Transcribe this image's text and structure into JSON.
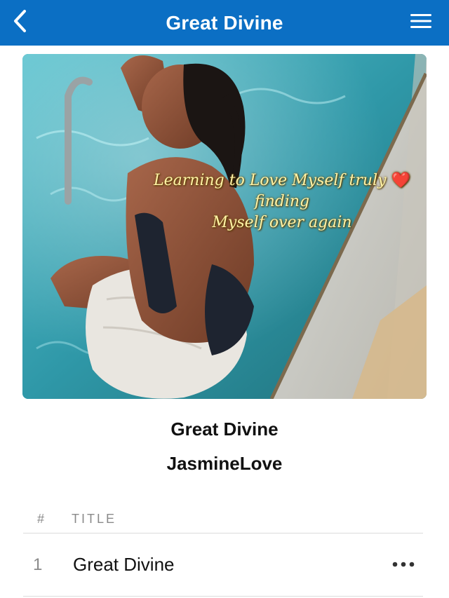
{
  "header": {
    "title": "Great Divine",
    "back_icon": "chevron-left-icon",
    "menu_icon": "hamburger-menu-icon",
    "background_color": "#0b6fc4"
  },
  "artwork": {
    "overlay_lines": [
      "Learning to Love Myself truly",
      "finding",
      "Myself over again"
    ],
    "overlay_emoji": "❤️"
  },
  "album": {
    "title": "Great Divine",
    "artist": "JasmineLove"
  },
  "track_list": {
    "columns": {
      "number": "#",
      "title": "TITLE"
    },
    "tracks": [
      {
        "number": "1",
        "title": "Great Divine",
        "more_icon": "more-horizontal-icon"
      }
    ]
  }
}
